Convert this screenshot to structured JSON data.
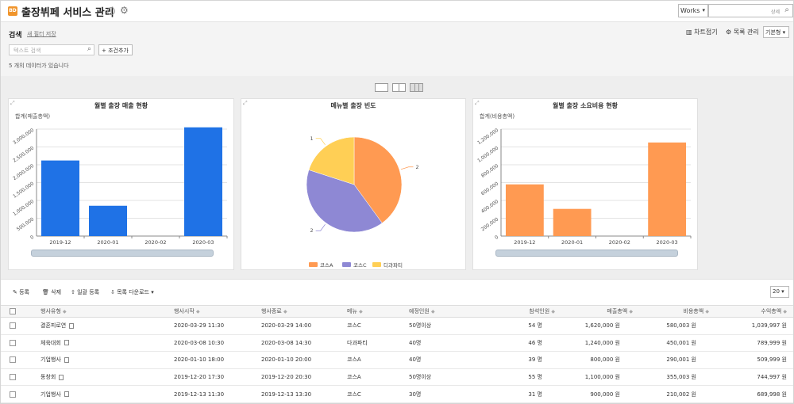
{
  "header": {
    "logo_text": "BD",
    "title": "출장뷔페 서비스 관리",
    "workspace": "Works",
    "search_detail": "상세"
  },
  "search": {
    "label": "검색",
    "save_filter": "새 필터 저장",
    "placeholder": "텍스트 검색",
    "add_condition": "+ 조건추가",
    "result_count": "5 개의 데이터가 있습니다",
    "chart_fold": "차트접기",
    "list_manage": "목록 관리",
    "view_select": "기본형"
  },
  "colors": {
    "blue": "#1f72e6",
    "orange": "#ff9a52",
    "purple": "#8e88d4",
    "yellow": "#ffcf55"
  },
  "chart_data": [
    {
      "type": "bar",
      "title": "월별 출장 매출 현황",
      "ylabel": "합계(매출총액)",
      "categories": [
        "2019-12",
        "2020-01",
        "2020-02",
        "2020-03"
      ],
      "values": [
        2120000,
        850000,
        0,
        3050000
      ],
      "yticks": [
        "0",
        "500,000",
        "1,000,000",
        "1,500,000",
        "2,000,000",
        "2,500,000",
        "3,000,000"
      ],
      "ylim": [
        0,
        3000000
      ],
      "color": "#1f72e6"
    },
    {
      "type": "pie",
      "title": "메뉴별 출장 빈도",
      "slices": [
        {
          "name": "코스A",
          "value": 2,
          "color": "#ff9a52"
        },
        {
          "name": "코스C",
          "value": 2,
          "color": "#8e88d4"
        },
        {
          "name": "디과파티",
          "value": 1,
          "color": "#ffcf55"
        }
      ],
      "legend": "bottom"
    },
    {
      "type": "bar",
      "title": "월별 출장 소요비용 현황",
      "ylabel": "합계(비용총액)",
      "categories": [
        "2019-12",
        "2020-01",
        "2020-02",
        "2020-03"
      ],
      "values": [
        580000,
        305000,
        0,
        1050000
      ],
      "yticks": [
        "0",
        "200,000",
        "400,000",
        "600,000",
        "800,000",
        "1,000,000",
        "1,200,000"
      ],
      "ylim": [
        0,
        1200000
      ],
      "color": "#ff9a52"
    }
  ],
  "toolbar": {
    "register": "등록",
    "delete": "삭제",
    "bulk_register": "일괄 등록",
    "download": "목록 다운로드",
    "page_size": "20"
  },
  "table": {
    "headers": [
      "행사유형",
      "행사시작",
      "행사종료",
      "메뉴",
      "예정인원",
      "참석인원",
      "매출총액",
      "비용총액",
      "수익총액"
    ],
    "rows": [
      [
        "결혼피로연",
        "2020-03-29 11:30",
        "2020-03-29 14:00",
        "코스C",
        "50명이상",
        "54 명",
        "1,620,000 원",
        "580,003 원",
        "1,039,997 원"
      ],
      [
        "체육대회",
        "2020-03-08 10:30",
        "2020-03-08 14:30",
        "다과파티",
        "40명",
        "46 명",
        "1,240,000 원",
        "450,001 원",
        "789,999 원"
      ],
      [
        "기업행사",
        "2020-01-10 18:00",
        "2020-01-10 20:00",
        "코스A",
        "40명",
        "39 명",
        "800,000 원",
        "290,001 원",
        "509,999 원"
      ],
      [
        "동창회",
        "2019-12-20 17:30",
        "2019-12-20 20:30",
        "코스A",
        "50명이상",
        "55 명",
        "1,100,000 원",
        "355,003 원",
        "744,997 원"
      ],
      [
        "기업행사",
        "2019-12-13 11:30",
        "2019-12-13 13:30",
        "코스C",
        "30명",
        "31 명",
        "900,000 원",
        "210,002 원",
        "689,998 원"
      ]
    ]
  }
}
